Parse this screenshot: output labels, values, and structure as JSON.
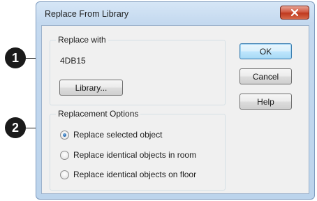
{
  "window": {
    "title": "Replace From Library",
    "close_glyph": "✕"
  },
  "replace_with": {
    "legend": "Replace with",
    "value": "4DB15",
    "library_button": "Library..."
  },
  "actions": {
    "ok": "OK",
    "cancel": "Cancel",
    "help": "Help"
  },
  "replacement_options": {
    "legend": "Replacement Options",
    "options": [
      {
        "label": "Replace selected object",
        "selected": true
      },
      {
        "label": "Replace identical objects in room",
        "selected": false
      },
      {
        "label": "Replace identical objects on floor",
        "selected": false
      }
    ]
  },
  "callouts": [
    "1",
    "2"
  ],
  "colors": {
    "title_bar": "#c4d9ef",
    "close_button": "#c0391f",
    "default_button_border": "#3c7fb1",
    "radio_selected": "#1c5fa8",
    "callout": "#1a1a1a"
  }
}
